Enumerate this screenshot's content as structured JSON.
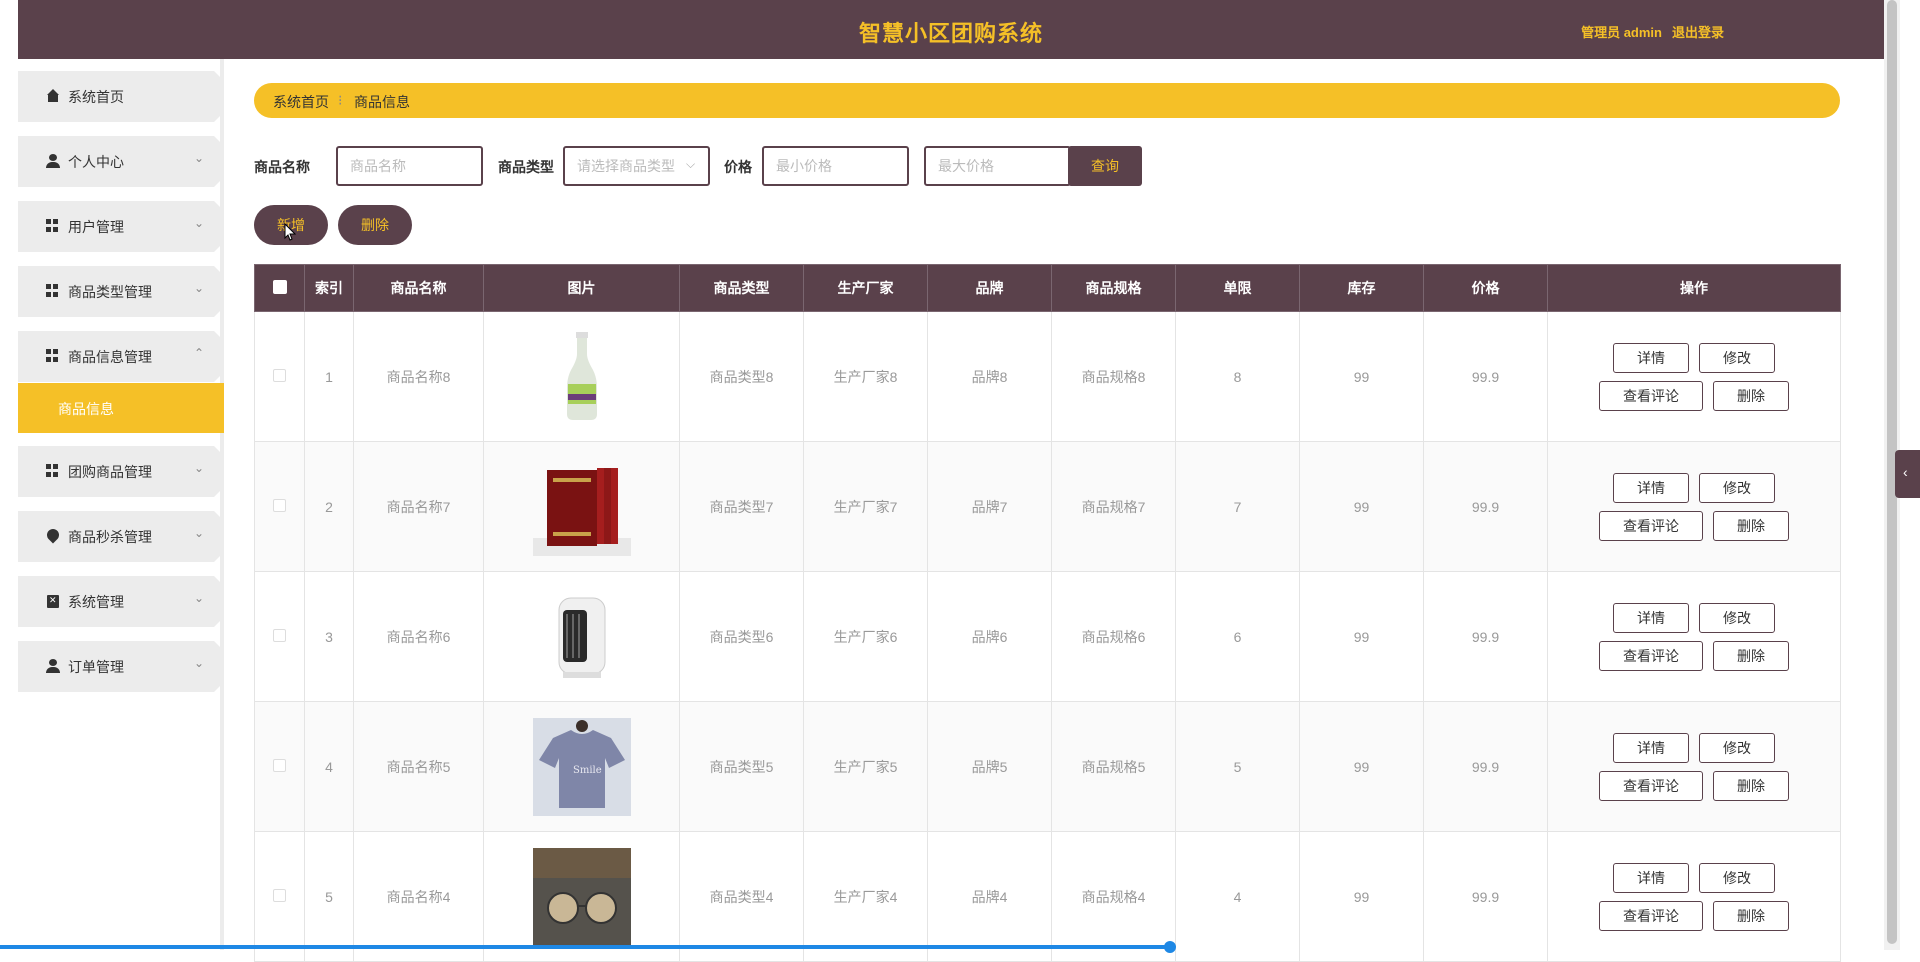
{
  "header": {
    "title": "智慧小区团购系统",
    "admin": "管理员 admin",
    "logout": "退出登录"
  },
  "sidebar": {
    "items": [
      {
        "label": "系统首页",
        "icon": "home-icon",
        "chevron": ""
      },
      {
        "label": "个人中心",
        "icon": "user-icon",
        "chevron": "⌄"
      },
      {
        "label": "用户管理",
        "icon": "grid-icon",
        "chevron": "⌄"
      },
      {
        "label": "商品类型管理",
        "icon": "grid-icon",
        "chevron": "⌄"
      },
      {
        "label": "商品信息管理",
        "icon": "grid-icon",
        "chevron": "⌃"
      },
      {
        "label": "团购商品管理",
        "icon": "grid-icon",
        "chevron": "⌄"
      },
      {
        "label": "商品秒杀管理",
        "icon": "pin-icon",
        "chevron": "⌄"
      },
      {
        "label": "系统管理",
        "icon": "clipboard-icon",
        "chevron": "⌄"
      },
      {
        "label": "订单管理",
        "icon": "user-icon",
        "chevron": "⌄"
      }
    ],
    "sub_active": "商品信息"
  },
  "breadcrumb": {
    "home": "系统首页",
    "separator": "⁝",
    "current": "商品信息"
  },
  "filters": {
    "name_label": "商品名称",
    "name_placeholder": "商品名称",
    "type_label": "商品类型",
    "type_placeholder": "请选择商品类型",
    "price_label": "价格",
    "min_placeholder": "最小价格",
    "max_placeholder": "最大价格",
    "query": "查询"
  },
  "actions": {
    "add": "新增",
    "delete": "删除"
  },
  "table": {
    "headers": [
      "",
      "索引",
      "商品名称",
      "图片",
      "商品类型",
      "生产厂家",
      "品牌",
      "商品规格",
      "单限",
      "库存",
      "价格",
      "操作"
    ],
    "op_labels": {
      "detail": "详情",
      "edit": "修改",
      "comments": "查看评论",
      "delete": "删除"
    },
    "rows": [
      {
        "index": "1",
        "name": "商品名称8",
        "image": "drink-bottle",
        "type": "商品类型8",
        "maker": "生产厂家8",
        "brand": "品牌8",
        "spec": "商品规格8",
        "limit": "8",
        "stock": "99",
        "price": "99.9"
      },
      {
        "index": "2",
        "name": "商品名称7",
        "image": "book-set",
        "type": "商品类型7",
        "maker": "生产厂家7",
        "brand": "品牌7",
        "spec": "商品规格7",
        "limit": "7",
        "stock": "99",
        "price": "99.9"
      },
      {
        "index": "3",
        "name": "商品名称6",
        "image": "heater",
        "type": "商品类型6",
        "maker": "生产厂家6",
        "brand": "品牌6",
        "spec": "商品规格6",
        "limit": "6",
        "stock": "99",
        "price": "99.9"
      },
      {
        "index": "4",
        "name": "商品名称5",
        "image": "tshirt",
        "type": "商品类型5",
        "maker": "生产厂家5",
        "brand": "品牌5",
        "spec": "商品规格5",
        "limit": "5",
        "stock": "99",
        "price": "99.9"
      },
      {
        "index": "5",
        "name": "商品名称4",
        "image": "sunglasses",
        "type": "商品类型4",
        "maker": "生产厂家4",
        "brand": "品牌4",
        "spec": "商品规格4",
        "limit": "4",
        "stock": "99",
        "price": "99.9"
      }
    ]
  },
  "colors": {
    "primary": "#5a414b",
    "accent": "#f5c027"
  }
}
